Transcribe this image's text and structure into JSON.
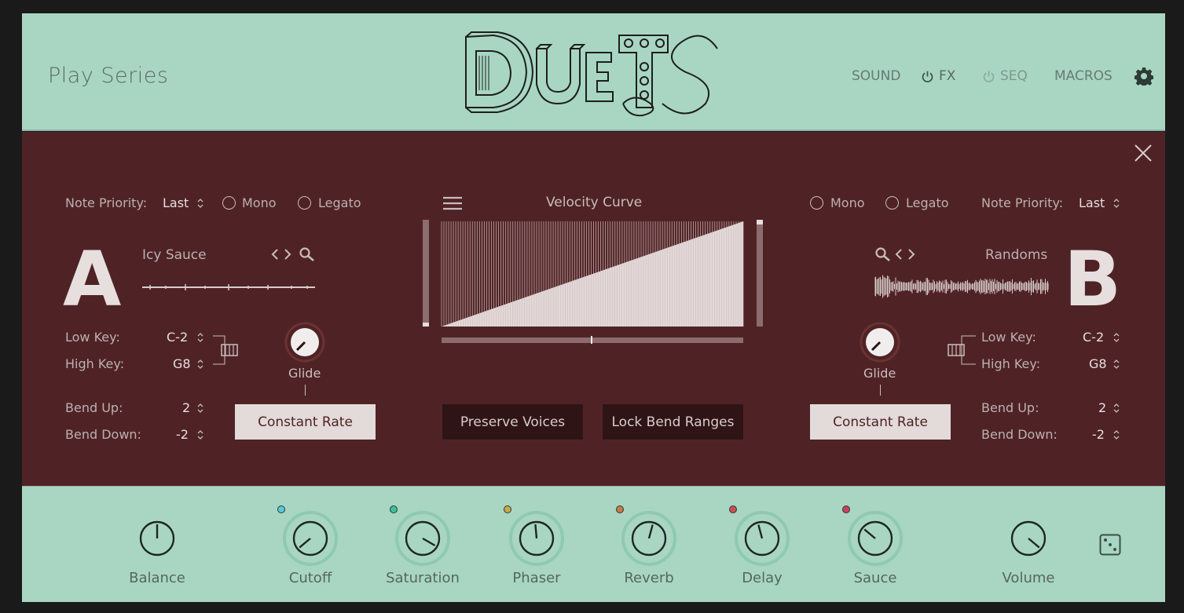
{
  "header": {
    "brand": "Play Series",
    "logo_text": "DUETS",
    "nav": {
      "sound": "SOUND",
      "fx": "FX",
      "seq": "SEQ",
      "macros": "MACROS"
    },
    "icons": {
      "settings": "gear-icon",
      "fx_power": "power-icon",
      "seq_power": "power-icon"
    }
  },
  "panel": {
    "left": {
      "note_priority_label": "Note Priority:",
      "note_priority_value": "Last",
      "mono_label": "Mono",
      "legato_label": "Legato",
      "letter": "A",
      "preset": "Icy Sauce",
      "low_key_label": "Low Key:",
      "low_key_value": "C-2",
      "high_key_label": "High Key:",
      "high_key_value": "G8",
      "bend_up_label": "Bend Up:",
      "bend_up_value": "2",
      "bend_down_label": "Bend Down:",
      "bend_down_value": "-2",
      "glide_label": "Glide",
      "glide_mode": "Constant Rate"
    },
    "right": {
      "note_priority_label": "Note Priority:",
      "note_priority_value": "Last",
      "mono_label": "Mono",
      "legato_label": "Legato",
      "letter": "B",
      "preset": "Randoms",
      "low_key_label": "Low Key:",
      "low_key_value": "C-2",
      "high_key_label": "High Key:",
      "high_key_value": "G8",
      "bend_up_label": "Bend Up:",
      "bend_up_value": "2",
      "bend_down_label": "Bend Down:",
      "bend_down_value": "-2",
      "glide_label": "Glide",
      "glide_mode": "Constant Rate"
    },
    "center": {
      "velocity_title": "Velocity Curve",
      "preserve_voices": "Preserve Voices",
      "lock_bend_ranges": "Lock Bend Ranges"
    }
  },
  "footer": {
    "knobs": [
      {
        "label": "Balance",
        "dot": null
      },
      {
        "label": "Cutoff",
        "dot": "#5fc8d6"
      },
      {
        "label": "Saturation",
        "dot": "#3fbf9a"
      },
      {
        "label": "Phaser",
        "dot": "#c9a84a"
      },
      {
        "label": "Reverb",
        "dot": "#c97a4a"
      },
      {
        "label": "Delay",
        "dot": "#c95050"
      },
      {
        "label": "Sauce",
        "dot": "#c94060"
      },
      {
        "label": "Volume",
        "dot": null
      }
    ]
  },
  "colors": {
    "header_bg": "#a8d6c2",
    "panel_bg": "#4f2325",
    "button_light": "#e3dada",
    "button_dark": "#2f1416"
  }
}
